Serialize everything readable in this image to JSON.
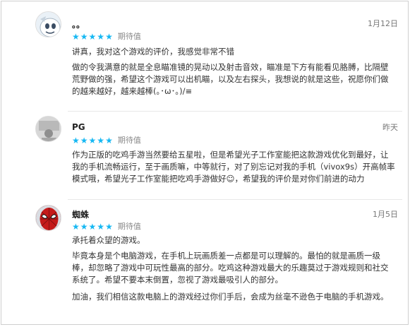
{
  "reviews": [
    {
      "name": "。。",
      "tag": "期待值",
      "date": "1月12日",
      "rating": 5,
      "paragraphs": [
        "讲真，我对这个游戏的评价，我感觉非常不错",
        "做的令我满意的就是全息瞄准镜的晃动以及射击音效，瞄准是下方有能看见胳膊，比隔壁荒野做的强，希望这个游戏可以出机瞄，以及左右探头，我想说的就是这些，祝愿你们做的越来越好，越来越棒(｡･ω･｡)/≡"
      ]
    },
    {
      "name": "PG",
      "tag": "期待值",
      "date": "昨天",
      "rating": 5,
      "paragraphs": [
        "作为正版的吃鸡手游当然要给五星啦，但是希望光子工作室能把这款游戏优化到最好，让我的手机流畅运行，至于画质嘛，中等就行，对了别忘记对我的手机（vivox9s）开高帧率模式哦，希望光子工作室能把吃鸡手游做好☺，希望我的评价是对你们前进的动力"
      ]
    },
    {
      "name": "蜘蛛",
      "tag": "期待值",
      "date": "1月5日",
      "rating": 5,
      "paragraphs": [
        "承托着众望的游戏。",
        "毕竟本身是个电脑游戏，在手机上玩画质差一点都是可以理解的。最怕的就是画质一级棒，却忽略了游戏中可玩性最高的部分。吃鸡这种游戏最大的乐趣莫过于游戏规则和社交系统了。希望不要本末倒置，忽视了游戏最吸引人的部分。",
        "加油，我们相信这款电脑上的游戏经过你们手后，会成为丝毫不逊色于电脑的手机游戏。"
      ]
    }
  ],
  "colors": {
    "star": "#16b8f3",
    "tag": "#8a8a8a",
    "text": "#333333"
  },
  "icons": {
    "star": "star-icon",
    "avatar_1": "cartoon-avatar",
    "avatar_2": "gray-avatar",
    "avatar_3": "spiderman-avatar"
  }
}
